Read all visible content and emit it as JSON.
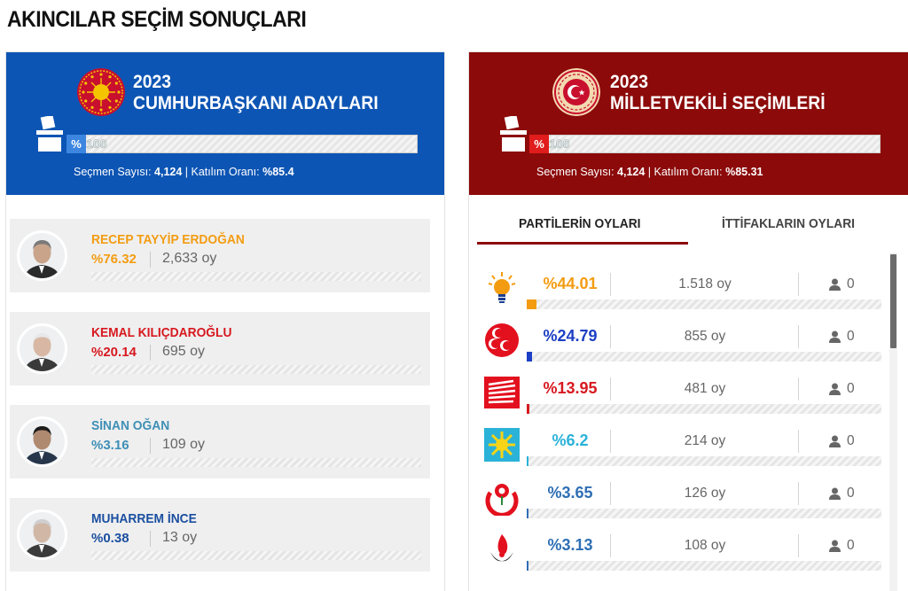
{
  "page_title": "AKINCILAR SEÇİM SONUÇLARI",
  "presidential": {
    "year": "2023",
    "title": "CUMHURBAŞKANI ADAYLARI",
    "progress_tag": "%",
    "progress_value": "100",
    "progress_fraction": 1.0,
    "stats_label1": "Seçmen Sayısı: ",
    "voters": "4,124",
    "stats_label2": " | Katılım Oranı: ",
    "turnout": "%85.4",
    "accent": "#0d55b4",
    "candidates": [
      {
        "name": "RECEP TAYYİP ERDOĞAN",
        "pct": "%76.32",
        "votes": "2,633 oy",
        "share": 0.7632,
        "color": "#f39c12"
      },
      {
        "name": "KEMAL KILIÇDAROĞLU",
        "pct": "%20.14",
        "votes": "695 oy",
        "share": 0.2014,
        "color": "#d71920"
      },
      {
        "name": "SİNAN OĞAN",
        "pct": "%3.16",
        "votes": "109 oy",
        "share": 0.0316,
        "color": "#3e8fb5"
      },
      {
        "name": "MUHARREM İNCE",
        "pct": "%0.38",
        "votes": "13 oy",
        "share": 0.0038,
        "color": "#1b4fa0"
      }
    ]
  },
  "parliament": {
    "year": "2023",
    "title": "MİLLETVEKİLİ SEÇİMLERİ",
    "progress_tag": "%",
    "progress_value": "100",
    "progress_fraction": 1.0,
    "stats_label1": "Seçmen Sayısı: ",
    "voters": "4,124",
    "stats_label2": " | Katılım Oranı: ",
    "turnout": "%85.31",
    "accent": "#8c0a0a",
    "tabs": [
      "PARTİLERİN OYLARI",
      "İTTİFAKLARIN OYLARI"
    ],
    "parties": [
      {
        "logo": "ak-party-bulb-icon",
        "pct": "%44.01",
        "votes": "1.518 oy",
        "seats": "0",
        "share": 0.4401,
        "color": "#f39c12"
      },
      {
        "logo": "mhp-crescents-icon",
        "pct": "%24.79",
        "votes": "855 oy",
        "seats": "0",
        "share": 0.2479,
        "color": "#1c3fc4"
      },
      {
        "logo": "chp-six-arrows-icon",
        "pct": "%13.95",
        "votes": "481 oy",
        "seats": "0",
        "share": 0.1395,
        "color": "#d71920"
      },
      {
        "logo": "iyi-party-sun-icon",
        "pct": "%6.2",
        "votes": "214 oy",
        "seats": "0",
        "share": 0.062,
        "color": "#2bb2d8"
      },
      {
        "logo": "yeniden-refah-rose-icon",
        "pct": "%3.65",
        "votes": "126 oy",
        "seats": "0",
        "share": 0.0365,
        "color": "#2f6fb5"
      },
      {
        "logo": "bbp-flame-icon",
        "pct": "%3.13",
        "votes": "108 oy",
        "seats": "0",
        "share": 0.0313,
        "color": "#2f6fb5"
      }
    ]
  }
}
